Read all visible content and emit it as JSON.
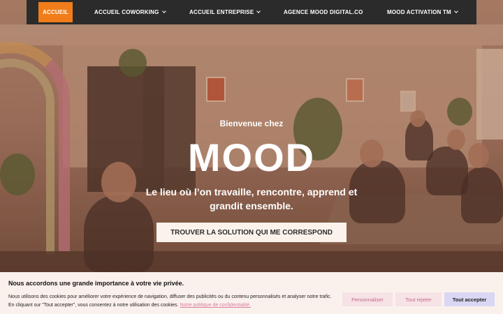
{
  "nav": {
    "items": [
      {
        "label": "ACCUEIL",
        "active": true,
        "dropdown": false
      },
      {
        "label": "ACCUEIL COWORKING",
        "active": false,
        "dropdown": true
      },
      {
        "label": "ACCUEIL ENTREPRISE",
        "active": false,
        "dropdown": true
      },
      {
        "label": "AGENCE MOOD DIGITAL.CO",
        "active": false,
        "dropdown": false
      },
      {
        "label": "MOOD ACTIVATION TM",
        "active": false,
        "dropdown": true
      }
    ],
    "active_color": "#f07d1a",
    "bg_color": "#2b2b2b"
  },
  "hero": {
    "welcome": "Bienvenue chez",
    "brand": "MOOD",
    "tagline": "Le lieu où l’on travaille, rencontre, apprend et grandit ensemble.",
    "cta_label": "TROUVER LA SOLUTION QUI ME CORRESPOND"
  },
  "cookie": {
    "title": "Nous accordons une grande importance à votre vie privée.",
    "text_line1": "Nous utilisons des cookies pour améliorer votre expérience de navigation, diffuser des publicités ou du contenu personnalisés et analyser notre trafic.",
    "text_line2": "En cliquant sur \"Tout accepter\", vous consentez à notre utilisation des cookies.",
    "policy_link": "Notre politique de confidentialité.",
    "customize_label": "Personnaliser",
    "reject_label": "Tout rejeter",
    "accept_label": "Tout accepter"
  }
}
